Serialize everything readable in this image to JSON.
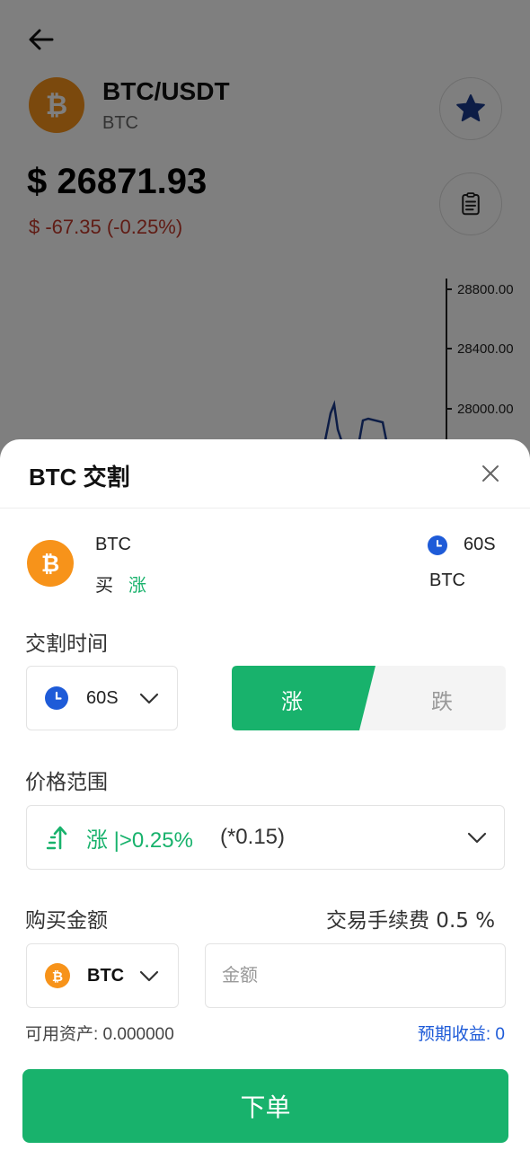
{
  "background": {
    "pair_title": "BTC/USDT",
    "pair_sub": "BTC",
    "price": "$ 26871.93",
    "change": "$ -67.35 (-0.25%)",
    "chart_ticks": [
      "28800.00",
      "28400.00",
      "28000.00"
    ]
  },
  "sheet": {
    "title": "BTC 交割",
    "coin_name": "BTC",
    "buy_label": "买",
    "buy_direction": "涨",
    "time_value": "60S",
    "coin_right": "BTC",
    "delivery_time_label": "交割时间",
    "time_select_value": "60S",
    "up_label": "涨",
    "down_label": "跌",
    "price_range_label": "价格范围",
    "price_range_value": "涨 |>0.25%",
    "price_range_multiplier": "(*0.15)",
    "amount_label": "购买金额",
    "fee_label": "交易手续费 0.5 %",
    "currency_select_value": "BTC",
    "amount_placeholder": "金额",
    "available_assets": "可用资产: 0.000000",
    "expected_profit": "预期收益: 0",
    "submit_label": "下单"
  },
  "colors": {
    "accent_green": "#18b26c",
    "accent_blue": "#1e5bd8",
    "bitcoin_orange": "#f7931a",
    "negative_red": "#c0392b"
  }
}
